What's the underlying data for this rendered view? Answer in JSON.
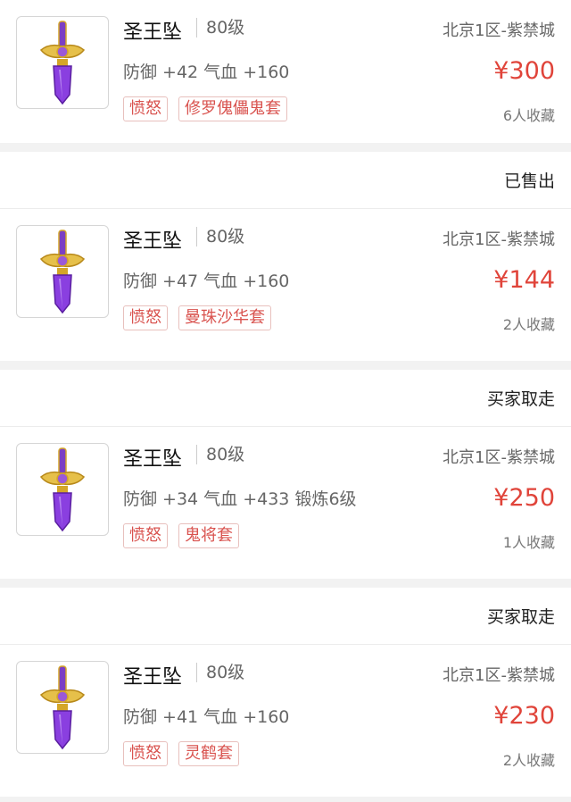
{
  "listings": [
    {
      "status": "",
      "name": "圣王坠",
      "level": "80级",
      "stats": "防御 +42 气血 +160",
      "tags": [
        "愤怒",
        "修罗傀儡鬼套"
      ],
      "server": "北京1区-紫禁城",
      "price": "¥300",
      "favorites": "6人收藏",
      "icon": "purple-sword-pendant-icon"
    },
    {
      "status": "已售出",
      "name": "圣王坠",
      "level": "80级",
      "stats": "防御 +47 气血 +160",
      "tags": [
        "愤怒",
        "曼珠沙华套"
      ],
      "server": "北京1区-紫禁城",
      "price": "¥144",
      "favorites": "2人收藏",
      "icon": "purple-sword-pendant-icon"
    },
    {
      "status": "买家取走",
      "name": "圣王坠",
      "level": "80级",
      "stats": "防御 +34 气血 +433 锻炼6级",
      "tags": [
        "愤怒",
        "鬼将套"
      ],
      "server": "北京1区-紫禁城",
      "price": "¥250",
      "favorites": "1人收藏",
      "icon": "purple-sword-pendant-icon"
    },
    {
      "status": "买家取走",
      "name": "圣王坠",
      "level": "80级",
      "stats": "防御 +41 气血 +160",
      "tags": [
        "愤怒",
        "灵鹤套"
      ],
      "server": "北京1区-紫禁城",
      "price": "¥230",
      "favorites": "2人收藏",
      "icon": "purple-sword-pendant-icon"
    }
  ],
  "colors": {
    "price": "#e0443a",
    "tag": "#d9534f",
    "gem": "#7b3fc4",
    "gold": "#d4a628"
  }
}
